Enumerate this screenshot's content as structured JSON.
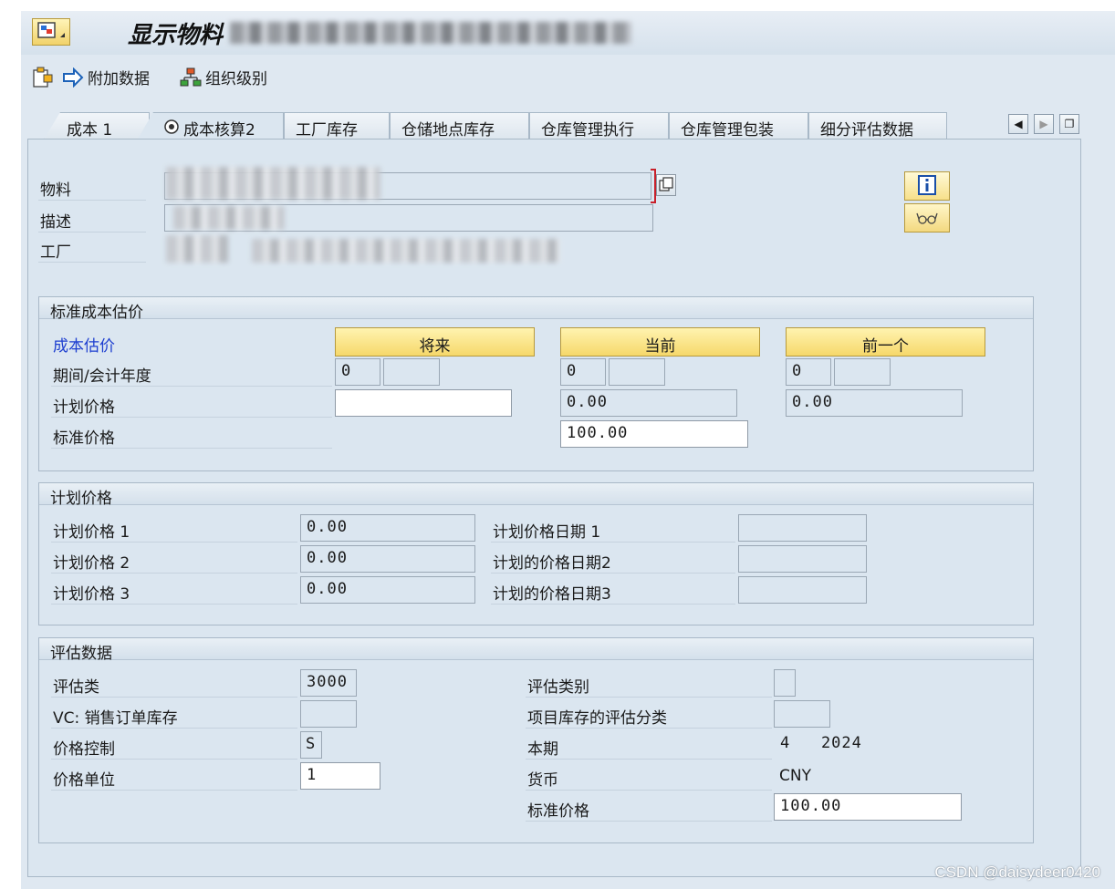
{
  "window": {
    "title": "显示物料"
  },
  "toolbar": {
    "additional_data": "附加数据",
    "org_levels": "组织级别"
  },
  "tabs": [
    {
      "label": "成本 1"
    },
    {
      "label": "成本核算2"
    },
    {
      "label": "工厂库存"
    },
    {
      "label": "仓储地点库存"
    },
    {
      "label": "仓库管理执行"
    },
    {
      "label": "仓库管理包装"
    },
    {
      "label": "细分评估数据"
    }
  ],
  "header": {
    "material_label": "物料",
    "description_label": "描述",
    "plant_label": "工厂"
  },
  "std_cost": {
    "title": "标准成本估价",
    "cost_estimate_label": "成本估价",
    "future_btn": "将来",
    "current_btn": "当前",
    "previous_btn": "前一个",
    "period_label": "期间/会计年度",
    "planned_price_label": "计划价格",
    "standard_price_label": "标准价格",
    "future_period": "0",
    "current_period": "0",
    "previous_period": "0",
    "current_planned": "0.00",
    "previous_planned": "0.00",
    "current_standard": "100.00"
  },
  "planned": {
    "title": "计划价格",
    "price1_label": "计划价格 1",
    "price2_label": "计划价格 2",
    "price3_label": "计划价格 3",
    "price1": "0.00",
    "price2": "0.00",
    "price3": "0.00",
    "date1_label": "计划价格日期 1",
    "date2_label": "计划的价格日期2",
    "date3_label": "计划的价格日期3"
  },
  "valuation": {
    "title": "评估数据",
    "class_label": "评估类",
    "class_value": "3000",
    "vc_label": "VC: 销售订单库存",
    "price_control_label": "价格控制",
    "price_control_value": "S",
    "price_unit_label": "价格单位",
    "price_unit_value": "1",
    "category_label": "评估类别",
    "project_stock_label": "项目库存的评估分类",
    "period_label": "本期",
    "period_value": "4   2024",
    "currency_label": "货币",
    "currency_value": "CNY",
    "standard_price_label": "标准价格",
    "standard_price_value": "100.00"
  },
  "watermark": "CSDN @daisydeer0420"
}
